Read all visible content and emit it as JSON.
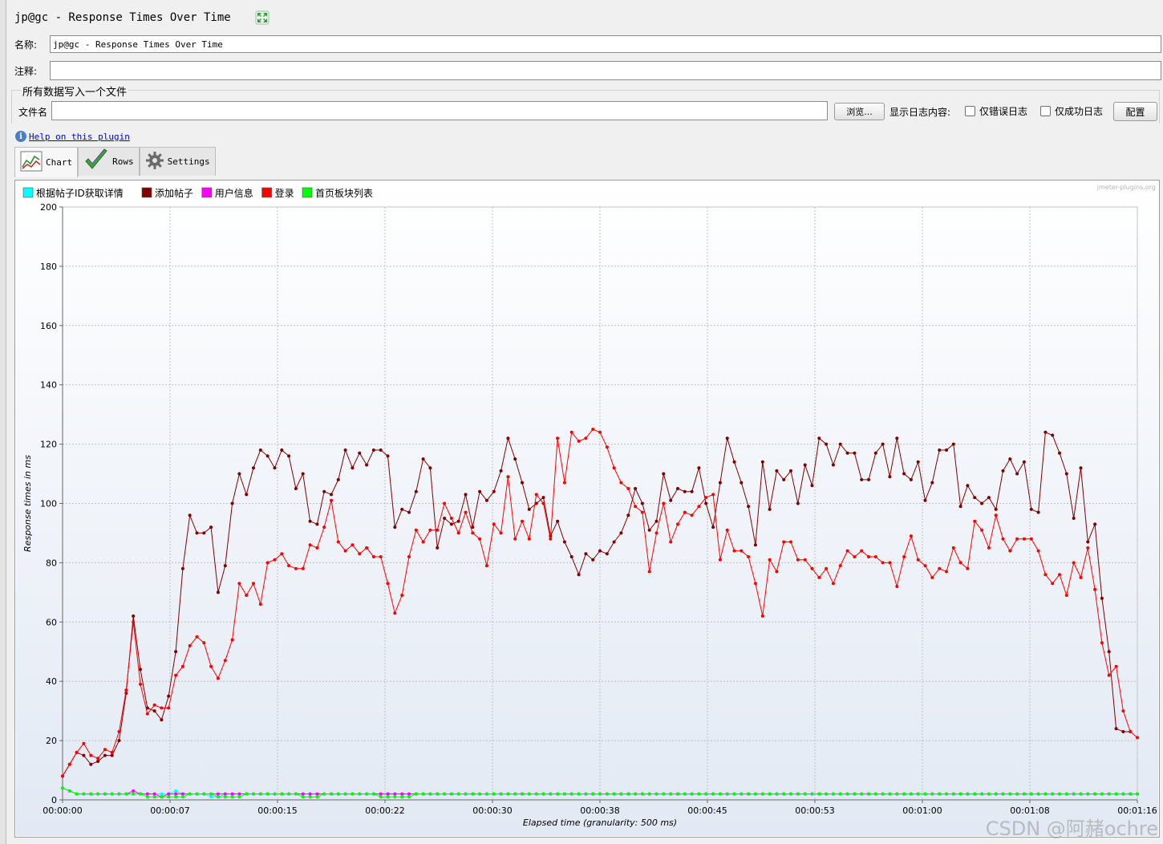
{
  "window": {
    "title": "jp@gc - Response Times Over Time"
  },
  "form": {
    "name_label": "名称:",
    "name_value": "jp@gc - Response Times Over Time",
    "comment_label": "注释:",
    "comment_value": ""
  },
  "file_group": {
    "title": "所有数据写入一个文件",
    "file_label": "文件名",
    "file_value": "",
    "browse_label": "浏览...",
    "log_content_label": "显示日志内容:",
    "errors_only_label": "仅错误日志",
    "errors_only_checked": false,
    "success_only_label": "仅成功日志",
    "success_only_checked": false,
    "config_label": "配置"
  },
  "help_link": "Help on this plugin",
  "tabs": [
    {
      "label": "Chart",
      "icon": "chart-icon",
      "active": true
    },
    {
      "label": "Rows",
      "icon": "checkmark-icon",
      "active": false
    },
    {
      "label": "Settings",
      "icon": "gear-icon",
      "active": false
    }
  ],
  "chart_watermark": "jmeter-plugins.org",
  "page_watermark": "CSDN @阿赭ochre",
  "chart_data": {
    "type": "line",
    "xlabel": "Elapsed time (granularity: 500 ms)",
    "ylabel": "Response times in ms",
    "ylim": [
      0,
      200
    ],
    "yticks": [
      0,
      20,
      40,
      60,
      80,
      100,
      120,
      140,
      160,
      180,
      200
    ],
    "xlim_seconds": [
      0,
      76
    ],
    "xtick_labels": [
      "00:00:00",
      "00:00:07",
      "00:00:15",
      "00:00:22",
      "00:00:30",
      "00:00:38",
      "00:00:45",
      "00:00:53",
      "00:01:00",
      "00:01:08",
      "00:01:16"
    ],
    "grid": true,
    "legend_position": "top-left",
    "x_seconds_step": 0.5,
    "series": [
      {
        "name": "根据帖子ID获取详情",
        "color": "#00ffff",
        "values": [
          4,
          3,
          2,
          2,
          2,
          2,
          2,
          2,
          2,
          2,
          2,
          2,
          2,
          2,
          2,
          2,
          3,
          2,
          2,
          2,
          2,
          1,
          1,
          2,
          2,
          2,
          2,
          2,
          2,
          2,
          2,
          2,
          2,
          2,
          2,
          2,
          2,
          2,
          2,
          2,
          2,
          2,
          2,
          2,
          2,
          2,
          2,
          2,
          2,
          2,
          2,
          2,
          2,
          2,
          2,
          2,
          2,
          2,
          2,
          2,
          2,
          2,
          2,
          2,
          2,
          2,
          2,
          2,
          2,
          2,
          2,
          2,
          2,
          2,
          2,
          2,
          2,
          2,
          2,
          2,
          2,
          2,
          2,
          2,
          2,
          2,
          2,
          2,
          2,
          2,
          2,
          2,
          2,
          2,
          2,
          2,
          2,
          2,
          2,
          2,
          2,
          2,
          2,
          2,
          2,
          2,
          2,
          2,
          2,
          2,
          2,
          2,
          2,
          2,
          2,
          2,
          2,
          2,
          2,
          2,
          2,
          2,
          2,
          2,
          2,
          2,
          2,
          2,
          2,
          2,
          2,
          2,
          2,
          2,
          2,
          2,
          2,
          2,
          2,
          2,
          2,
          2,
          2,
          2,
          2,
          2,
          2,
          2,
          2,
          2,
          2,
          2,
          2
        ]
      },
      {
        "name": "添加帖子",
        "color": "#800000",
        "values": [
          8,
          12,
          16,
          15,
          12,
          13,
          15,
          15,
          20,
          36,
          62,
          44,
          31,
          30,
          27,
          35,
          50,
          78,
          96,
          90,
          90,
          92,
          70,
          79,
          100,
          110,
          103,
          112,
          118,
          116,
          112,
          118,
          116,
          105,
          110,
          94,
          93,
          104,
          103,
          108,
          118,
          112,
          117,
          113,
          118,
          118,
          116,
          92,
          98,
          97,
          104,
          115,
          112,
          85,
          95,
          93,
          94,
          103,
          92,
          104,
          101,
          104,
          111,
          122,
          115,
          107,
          98,
          100,
          102,
          89,
          94,
          87,
          82,
          76,
          83,
          81,
          84,
          83,
          87,
          90,
          96,
          105,
          100,
          91,
          94,
          110,
          101,
          105,
          104,
          104,
          112,
          100,
          92,
          107,
          122,
          114,
          107,
          99,
          86,
          114,
          98,
          111,
          108,
          111,
          100,
          113,
          106,
          122,
          120,
          113,
          120,
          117,
          117,
          108,
          108,
          117,
          120,
          109,
          122,
          110,
          108,
          114,
          101,
          107,
          118,
          118,
          120,
          99,
          106,
          102,
          100,
          102,
          98,
          111,
          115,
          110,
          114,
          98,
          97,
          124,
          123,
          117,
          110,
          95,
          112,
          87,
          93,
          68,
          50,
          24,
          23,
          23
        ]
      },
      {
        "name": "用户信息",
        "color": "#ff00ff",
        "values": [
          4,
          3,
          2,
          2,
          2,
          2,
          2,
          2,
          2,
          2,
          3,
          2,
          2,
          2,
          1,
          2,
          2,
          2,
          2,
          2,
          2,
          2,
          2,
          2,
          2,
          2,
          2,
          2,
          2,
          2,
          2,
          2,
          2,
          2,
          2,
          2,
          2,
          2,
          2,
          2,
          2,
          2,
          2,
          2,
          2,
          2,
          2,
          2,
          2,
          2,
          2,
          2,
          2,
          2,
          2,
          2,
          2,
          2,
          2,
          2,
          2,
          2,
          2,
          2,
          2,
          2,
          2,
          2,
          2,
          2,
          2,
          2,
          2,
          2,
          2,
          2,
          2,
          2,
          2,
          2,
          2,
          2,
          2,
          2,
          2,
          2,
          2,
          2,
          2,
          2,
          2,
          2,
          2,
          2,
          2,
          2,
          2,
          2,
          2,
          2,
          2,
          2,
          2,
          2,
          2,
          2,
          2,
          2,
          2,
          2,
          2,
          2,
          2,
          2,
          2,
          2,
          2,
          2,
          2,
          2,
          2,
          2,
          2,
          2,
          2,
          2,
          2,
          2,
          2,
          2,
          2,
          2,
          2,
          2,
          2,
          2,
          2,
          2,
          2,
          2,
          2,
          2,
          2,
          2,
          2,
          2,
          2,
          2,
          2,
          2,
          2,
          2,
          2
        ]
      },
      {
        "name": "登录",
        "color": "#ff0000",
        "values": [
          8,
          12,
          16,
          19,
          15,
          14,
          17,
          16,
          23,
          37,
          60,
          39,
          29,
          32,
          31,
          31,
          42,
          45,
          52,
          55,
          53,
          45,
          41,
          47,
          54,
          73,
          69,
          73,
          66,
          80,
          81,
          83,
          79,
          78,
          78,
          86,
          85,
          92,
          101,
          87,
          84,
          86,
          83,
          85,
          82,
          82,
          73,
          63,
          69,
          82,
          91,
          87,
          91,
          91,
          100,
          95,
          90,
          97,
          90,
          88,
          79,
          93,
          90,
          109,
          88,
          94,
          88,
          103,
          100,
          88,
          122,
          107,
          124,
          121,
          122,
          125,
          124,
          119,
          112,
          107,
          105,
          99,
          97,
          77,
          90,
          100,
          87,
          93,
          97,
          96,
          99,
          102,
          103,
          81,
          91,
          84,
          84,
          82,
          73,
          62,
          81,
          77,
          87,
          87,
          81,
          81,
          78,
          75,
          78,
          73,
          79,
          84,
          82,
          84,
          82,
          82,
          80,
          80,
          72,
          82,
          89,
          81,
          79,
          75,
          78,
          77,
          85,
          80,
          78,
          94,
          91,
          85,
          96,
          88,
          84,
          88,
          88,
          88,
          84,
          76,
          73,
          76,
          69,
          80,
          75,
          85,
          71,
          53,
          42,
          45,
          30,
          23,
          21
        ]
      },
      {
        "name": "首页板块列表",
        "color": "#00ff00",
        "values": [
          4,
          3,
          2,
          2,
          2,
          2,
          2,
          2,
          2,
          2,
          2,
          2,
          1,
          1,
          1,
          1,
          1,
          1,
          2,
          2,
          2,
          2,
          1,
          1,
          1,
          1,
          2,
          2,
          2,
          2,
          2,
          2,
          2,
          2,
          1,
          1,
          1,
          2,
          2,
          2,
          2,
          2,
          2,
          2,
          2,
          1,
          1,
          1,
          1,
          1,
          2,
          2,
          2,
          2,
          2,
          2,
          2,
          2,
          2,
          2,
          2,
          2,
          2,
          2,
          2,
          2,
          2,
          2,
          2,
          2,
          2,
          2,
          2,
          2,
          2,
          2,
          2,
          2,
          2,
          2,
          2,
          2,
          2,
          2,
          2,
          2,
          2,
          2,
          2,
          2,
          2,
          2,
          2,
          2,
          2,
          2,
          2,
          2,
          2,
          2,
          2,
          2,
          2,
          2,
          2,
          2,
          2,
          2,
          2,
          2,
          2,
          2,
          2,
          2,
          2,
          2,
          2,
          2,
          2,
          2,
          2,
          2,
          2,
          2,
          2,
          2,
          2,
          2,
          2,
          2,
          2,
          2,
          2,
          2,
          2,
          2,
          2,
          2,
          2,
          2,
          2,
          2,
          2,
          2,
          2,
          2,
          2,
          2,
          2,
          2,
          2,
          2,
          2
        ]
      }
    ]
  }
}
